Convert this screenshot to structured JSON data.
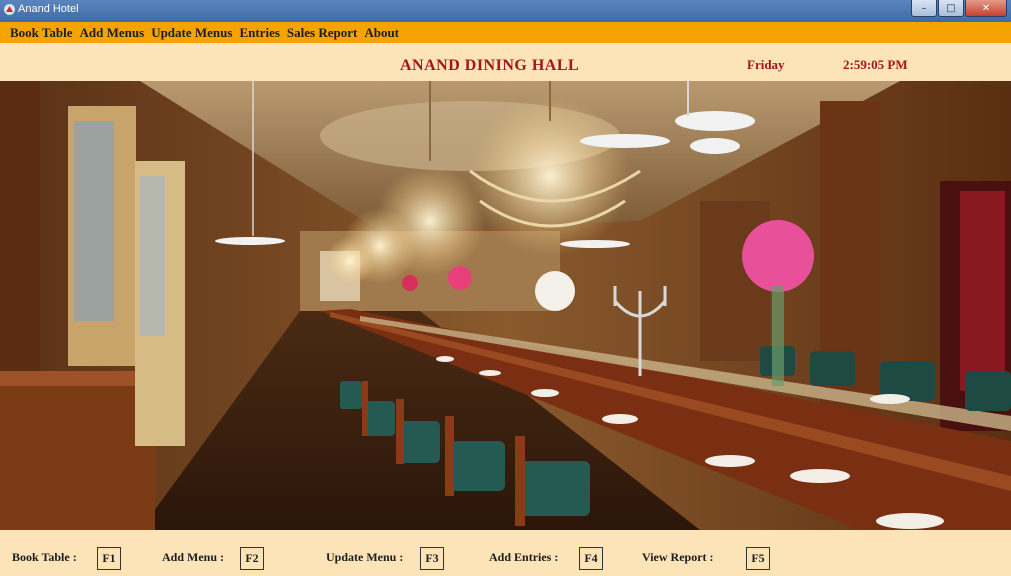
{
  "window": {
    "title": "Anand Hotel"
  },
  "menu": [
    "Book Table",
    "Add Menus",
    "Update Menus",
    "Entries",
    "Sales Report",
    "About"
  ],
  "header": {
    "hall_title": "ANAND DINING HALL",
    "day": "Friday",
    "time": "2:59:05 PM"
  },
  "colors": {
    "menubar": "#f5a300",
    "panel": "#fde3b8",
    "accent": "#a5131b",
    "titlebar": "#4a76b0"
  },
  "picture": {
    "subject": "dining-hall-photo"
  },
  "shortcuts": [
    {
      "label": "Book Table :",
      "key": "F1"
    },
    {
      "label": "Add Menu :",
      "key": "F2"
    },
    {
      "label": "Update Menu :",
      "key": "F3"
    },
    {
      "label": "Add Entries :",
      "key": "F4"
    },
    {
      "label": "View Report :",
      "key": "F5"
    }
  ]
}
